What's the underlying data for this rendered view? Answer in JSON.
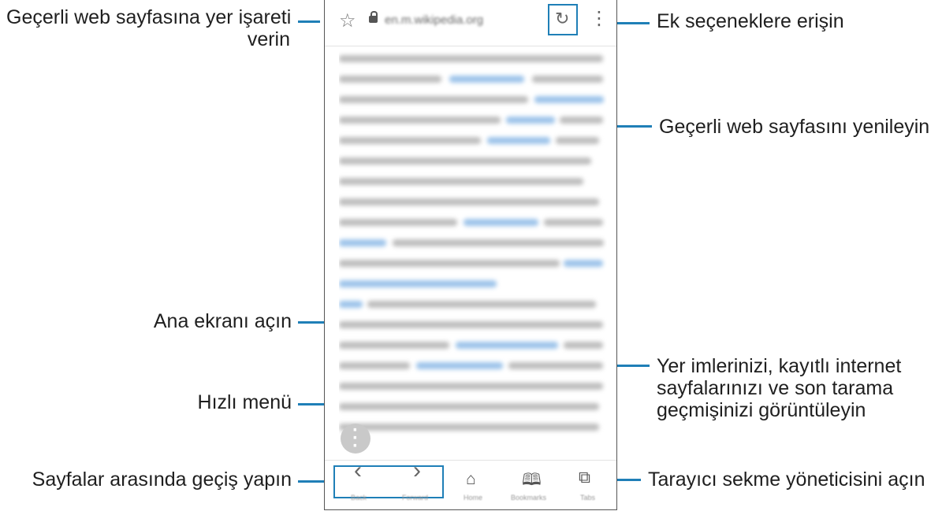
{
  "callouts": {
    "bookmark_line1": "Geçerli web sayfasına yer işareti",
    "bookmark_line2": "verin",
    "more_options": "Ek seçeneklere erişin",
    "refresh": "Geçerli web sayfasını yenileyin",
    "home": "Ana ekranı açın",
    "bookmarks_line1": "Yer imlerinizi, kayıtlı internet",
    "bookmarks_line2": "sayfalarınızı ve son tarama",
    "bookmarks_line3": "geçmişinizi görüntüleyin",
    "quick_menu": "Hızlı menü",
    "navigate_pages": "Sayfalar arasında geçiş yapın",
    "tab_manager": "Tarayıcı sekme yöneticisini açın"
  },
  "browser": {
    "url": "en.m.wikipedia.org",
    "nav_labels": {
      "back": "Back",
      "forward": "Forward",
      "home": "Home",
      "bookmarks": "Bookmarks",
      "tabs": "Tabs"
    }
  },
  "colors": {
    "accent": "#1f7fb7",
    "link_blur": "#9cc3ea",
    "text_blur": "#bdbdbd"
  },
  "icons": [
    "star-icon",
    "lock-icon",
    "refresh-icon",
    "more-options-icon",
    "quick-menu-icon",
    "back-chevron-icon",
    "forward-chevron-icon",
    "home-icon",
    "bookmarks-icon",
    "tabs-icon"
  ]
}
